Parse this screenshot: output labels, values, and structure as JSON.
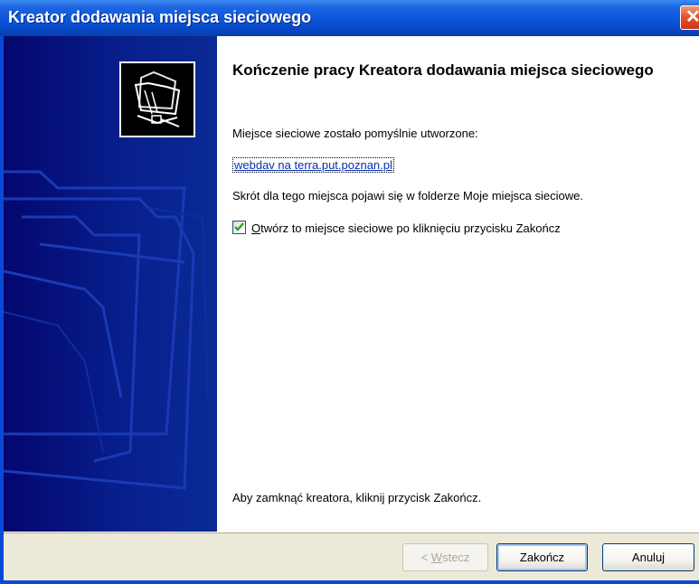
{
  "window": {
    "title": "Kreator dodawania miejsca sieciowego",
    "close_glyph": "✕",
    "accent_color": "#0a55dc",
    "sidebar_color": "#04066e"
  },
  "content": {
    "heading": "Kończenie pracy Kreatora dodawania miejsca sieciowego",
    "success_text": "Miejsce sieciowe zostało pomyślnie utworzone:",
    "location_link": "webdav na terra.put.poznan.pl",
    "shortcut_text": "Skrót dla tego miejsca pojawi się w folderze Moje miejsca sieciowe.",
    "open_checkbox": {
      "checked": true,
      "mnemonic": "O",
      "label_rest": "twórz to miejsce sieciowe po kliknięciu przycisku Zakończ"
    },
    "close_instruction": "Aby zamknąć kreatora, kliknij przycisk Zakończ."
  },
  "buttons": {
    "back_prefix": "< ",
    "back_mnemonic": "W",
    "back_rest": "stecz",
    "finish": "Zakończ",
    "cancel": "Anuluj"
  },
  "icons": {
    "wizard_icon": "network-folder-icon",
    "sidebar_art": "folder-outlines-icon"
  }
}
